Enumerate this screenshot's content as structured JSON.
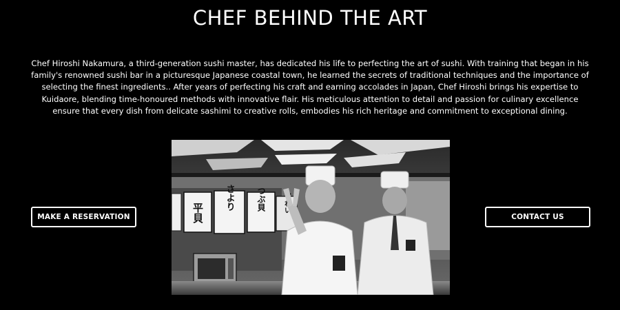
{
  "section": {
    "title": "CHEF BEHIND THE ART",
    "bio": "Chef Hiroshi Nakamura, a third-generation sushi master, has dedicated his life to perfecting the art of sushi. With training that began in his family's renowned sushi bar in a picturesque Japanese coastal town, he learned the secrets of traditional techniques and the importance of selecting the finest ingredients.. After years of perfecting his craft and earning accolades in Japan, Chef Hiroshi brings his expertise to Kuidaore, blending time-honoured methods with innovative flair. His meticulous attention to detail and passion for culinary excellence ensure that every dish from delicate sashimi to creative rolls, embodies his rich heritage and commitment to exceptional dining."
  },
  "buttons": {
    "reserve_label": "MAKE A RESERVATION",
    "contact_label": "CONTACT US"
  },
  "photo": {
    "signs": [
      "平貝",
      "さより",
      "つぶ貝",
      "ずわい"
    ]
  },
  "colors": {
    "background": "#000000",
    "text": "#ffffff",
    "button_border": "#ffffff"
  }
}
